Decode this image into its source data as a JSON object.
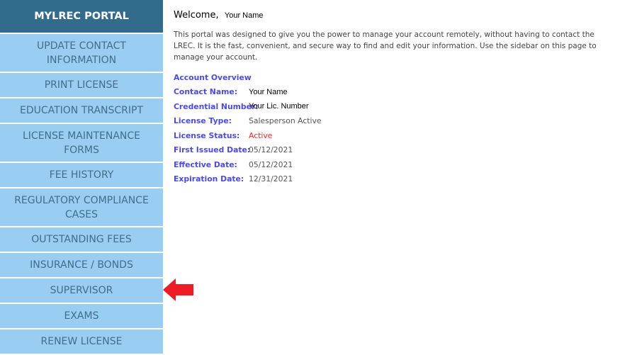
{
  "sidebar": {
    "title": "MYLREC PORTAL",
    "items": [
      {
        "label": "UPDATE CONTACT INFORMATION",
        "lines": 2
      },
      {
        "label": "PRINT LICENSE",
        "lines": 1
      },
      {
        "label": "EDUCATION TRANSCRIPT",
        "lines": 1
      },
      {
        "label": "LICENSE MAINTENANCE FORMS",
        "lines": 2
      },
      {
        "label": "FEE HISTORY",
        "lines": 1
      },
      {
        "label": "REGULATORY COMPLIANCE CASES",
        "lines": 2
      },
      {
        "label": "OUTSTANDING FEES",
        "lines": 1
      },
      {
        "label": "INSURANCE / BONDS",
        "lines": 1
      },
      {
        "label": "SUPERVISOR",
        "lines": 1
      },
      {
        "label": "EXAMS",
        "lines": 1
      },
      {
        "label": "RENEW LICENSE",
        "lines": 1
      }
    ]
  },
  "main": {
    "welcome": "Welcome,",
    "name": "Your Name",
    "intro": "This portal was designed to give you the power to manage your account remotely, without having to contact the LREC. It is the fast, convenient, and secure way to find and edit your information. Use the sidebar on this page to manage your account.",
    "overview_title": "Account Overview",
    "fields": [
      {
        "label": "Contact Name:",
        "value": "Your Name",
        "style": "b"
      },
      {
        "label": "Credential Number:",
        "value": "Your Lic. Number",
        "style": "b"
      },
      {
        "label": "License Type:",
        "value": "Salesperson Active",
        "style": ""
      },
      {
        "label": "License Status:",
        "value": "Active",
        "style": "red"
      },
      {
        "label": "First Issued Date:",
        "value": "05/12/2021",
        "style": ""
      },
      {
        "label": "Effective Date:",
        "value": "05/12/2021",
        "style": ""
      },
      {
        "label": "Expiration Date:",
        "value": "12/31/2021",
        "style": ""
      }
    ]
  },
  "annotation": {
    "arrow_color": "#ee1c24",
    "points_to": "SUPERVISOR"
  }
}
